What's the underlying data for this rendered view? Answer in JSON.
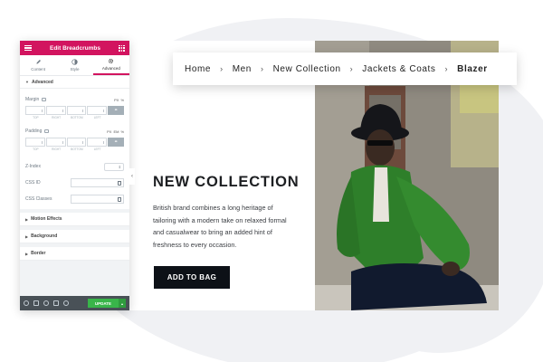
{
  "panel": {
    "title": "Edit Breadcrumbs",
    "tabs": [
      {
        "label": "Content",
        "icon": "pencil-icon"
      },
      {
        "label": "Style",
        "icon": "contrast-icon"
      },
      {
        "label": "Advanced",
        "icon": "gear-icon"
      }
    ],
    "active_tab": "Advanced",
    "advanced_section": "Advanced",
    "margin_label": "Margin",
    "padding_label": "Padding",
    "unit_px": "PX",
    "unit_pct": "%",
    "unit_em": "EM",
    "dimension_labels": [
      "TOP",
      "RIGHT",
      "BOTTOM",
      "LEFT"
    ],
    "zindex_label": "Z-Index",
    "css_id_label": "CSS ID",
    "css_classes_label": "CSS Classes",
    "collapsed_sections": [
      "Motion Effects",
      "Background",
      "Border"
    ],
    "update_label": "UPDATE",
    "accent_color": "#d2145f",
    "update_color": "#39b54a"
  },
  "breadcrumb": {
    "items": [
      "Home",
      "Men",
      "New Collection",
      "Jackets & Coats"
    ],
    "current": "Blazer",
    "separator": "›"
  },
  "content": {
    "headline": "NEW COLLECTION",
    "body": "British brand combines a long heritage of tailoring with a modern take on relaxed formal and casualwear to bring an added hint of freshness to every occasion.",
    "button_label": "ADD TO BAG"
  }
}
